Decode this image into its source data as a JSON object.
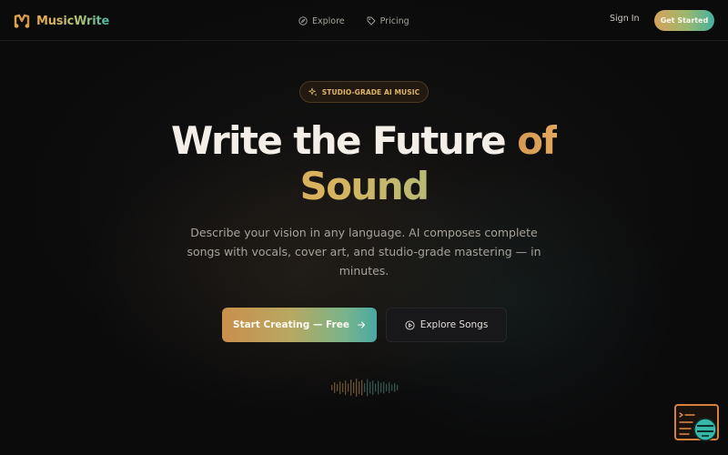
{
  "nav": {
    "brand": "MusicWrite",
    "links": [
      {
        "label": "Explore",
        "icon": "compass-icon"
      },
      {
        "label": "Pricing",
        "icon": "tag-icon"
      }
    ],
    "sign_in": "Sign In",
    "get_started": "Get Started"
  },
  "hero": {
    "badge": "STUDIO-GRADE AI MUSIC",
    "headline_part1": "Write the Future ",
    "headline_part2": "of",
    "headline_part3": "Sound",
    "subtext": "Describe your vision in any language. AI composes complete songs with vocals, cover art, and studio-grade mastering — in minutes.",
    "cta_primary": "Start Creating — Free",
    "cta_secondary": "Explore Songs"
  },
  "colors": {
    "background": "#0b0b0c",
    "accent_orange": "#d8a25a",
    "accent_teal": "#47b0a0",
    "badge_text": "#dfb46a"
  },
  "icons": {
    "logo": "music-logo-icon",
    "badge": "sparkles-icon",
    "cta_primary": "arrow-right-icon",
    "cta_secondary": "play-circle-icon",
    "waveform": "audio-waveform",
    "widget": "chat-support-icon"
  }
}
